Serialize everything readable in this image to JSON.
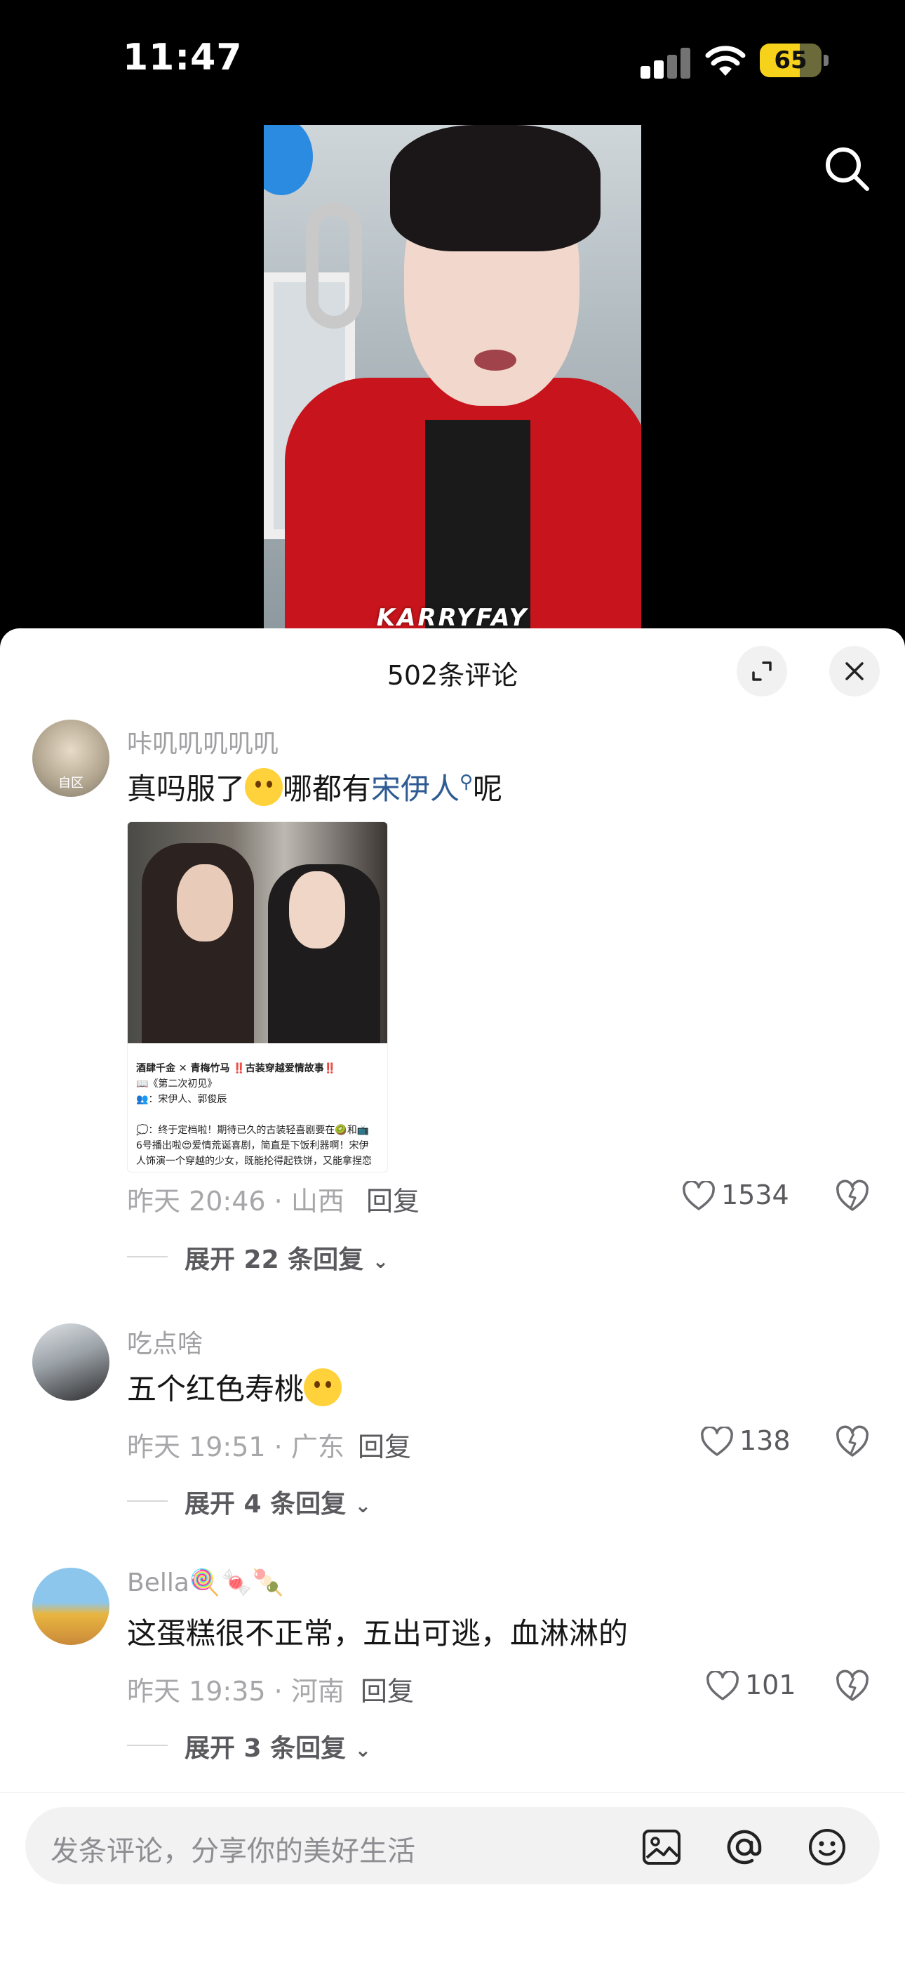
{
  "status_bar": {
    "time": "11:47",
    "battery": "65",
    "battery_level": 0.65
  },
  "video": {
    "watermark": "KARRYFAY"
  },
  "sheet": {
    "title": "502条评论"
  },
  "comments": [
    {
      "username": "咔叽叽叽叽叽",
      "avatar_label": "自区",
      "text_before": "真吗服了",
      "text_middle": "哪都有",
      "link": "宋伊人",
      "text_after": "呢",
      "attachment_lines": [
        "酒肆千金 ✕ 青梅竹马 ‼️古装穿越爱情故事‼️",
        "📖《第二次初见》",
        "👥：宋伊人、郭俊辰",
        "",
        "💭：终于定档啦！期待已久的古装轻喜剧要在🥝和📺",
        "6号播出啦😍爱情荒诞喜剧，简直是下饭利器啊！宋伊",
        "人饰演一个穿越的少女，既能抡得起铁饼，又能拿捏恋"
      ],
      "time_location": "昨天 20:46 · 山西",
      "reply": "回复",
      "likes": "1534",
      "expand": "展开 22 条回复"
    },
    {
      "username": "吃点啥",
      "text": "五个红色寿桃",
      "time_location": "昨天 19:51 · 广东",
      "reply": "回复",
      "likes": "138",
      "expand": "展开 4 条回复"
    },
    {
      "username": "Bella🍭🍬🍡",
      "text": "这蛋糕很不正常，五出可逃，血淋淋的",
      "time_location": "昨天 19:35 · 河南",
      "reply": "回复",
      "likes": "101",
      "expand": "展开 3 条回复"
    }
  ],
  "input": {
    "placeholder": "发条评论，分享你的美好生活"
  },
  "icons": [
    "search-icon",
    "expand-icon",
    "close-icon",
    "heart-icon",
    "dislike-icon",
    "chevron-down-icon",
    "image-icon",
    "at-icon",
    "emoji-icon"
  ]
}
